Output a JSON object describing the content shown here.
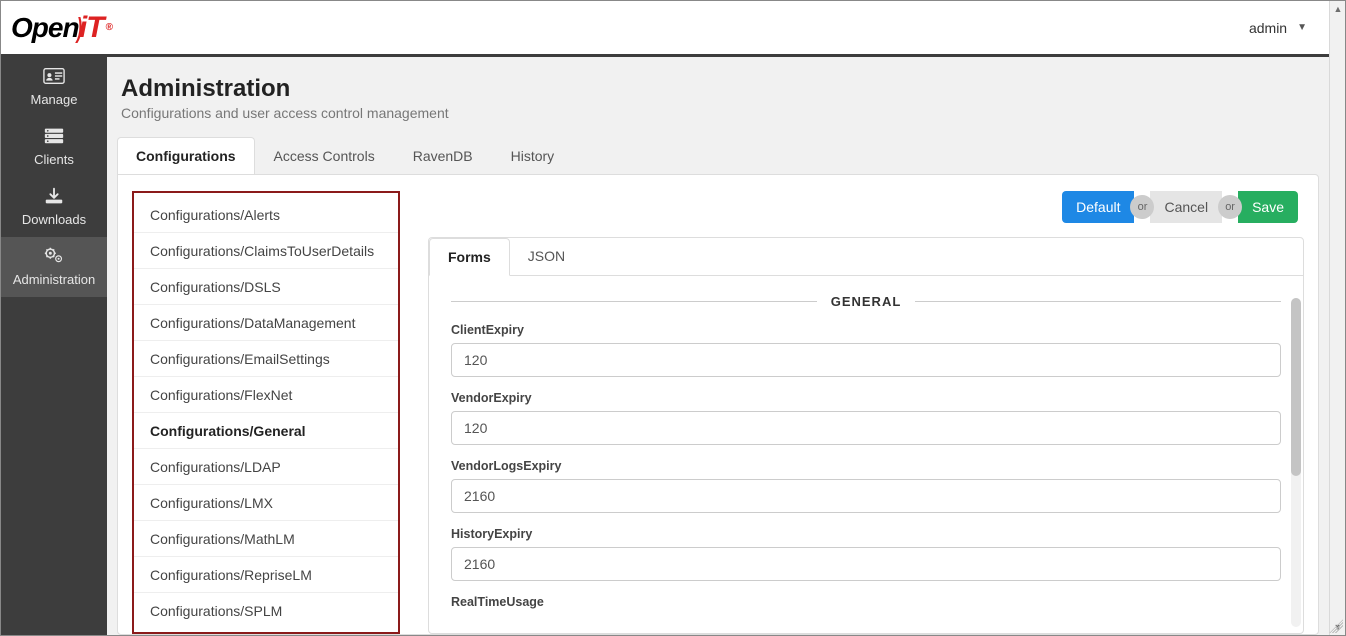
{
  "header": {
    "logo_open": "Open",
    "logo_it": "iT",
    "user_label": "admin"
  },
  "sidebar": {
    "items": [
      {
        "label": "Manage",
        "icon": "id-card-icon"
      },
      {
        "label": "Clients",
        "icon": "server-icon"
      },
      {
        "label": "Downloads",
        "icon": "download-icon"
      },
      {
        "label": "Administration",
        "icon": "gears-icon"
      }
    ],
    "active_index": 3
  },
  "page": {
    "title": "Administration",
    "subtitle": "Configurations and user access control management"
  },
  "tabs": {
    "items": [
      "Configurations",
      "Access Controls",
      "RavenDB",
      "History"
    ],
    "active_index": 0
  },
  "config_list": {
    "items": [
      "Configurations/Alerts",
      "Configurations/ClaimsToUserDetails",
      "Configurations/DSLS",
      "Configurations/DataManagement",
      "Configurations/EmailSettings",
      "Configurations/FlexNet",
      "Configurations/General",
      "Configurations/LDAP",
      "Configurations/LMX",
      "Configurations/MathLM",
      "Configurations/RepriseLM",
      "Configurations/SPLM"
    ],
    "active_index": 6
  },
  "buttons": {
    "default": "Default",
    "or1": "or",
    "cancel": "Cancel",
    "or2": "or",
    "save": "Save"
  },
  "inner_tabs": {
    "items": [
      "Forms",
      "JSON"
    ],
    "active_index": 0
  },
  "form": {
    "section": "GENERAL",
    "fields": [
      {
        "label": "ClientExpiry",
        "value": "120"
      },
      {
        "label": "VendorExpiry",
        "value": "120"
      },
      {
        "label": "VendorLogsExpiry",
        "value": "2160"
      },
      {
        "label": "HistoryExpiry",
        "value": "2160"
      },
      {
        "label": "RealTimeUsage",
        "value": ""
      }
    ]
  }
}
